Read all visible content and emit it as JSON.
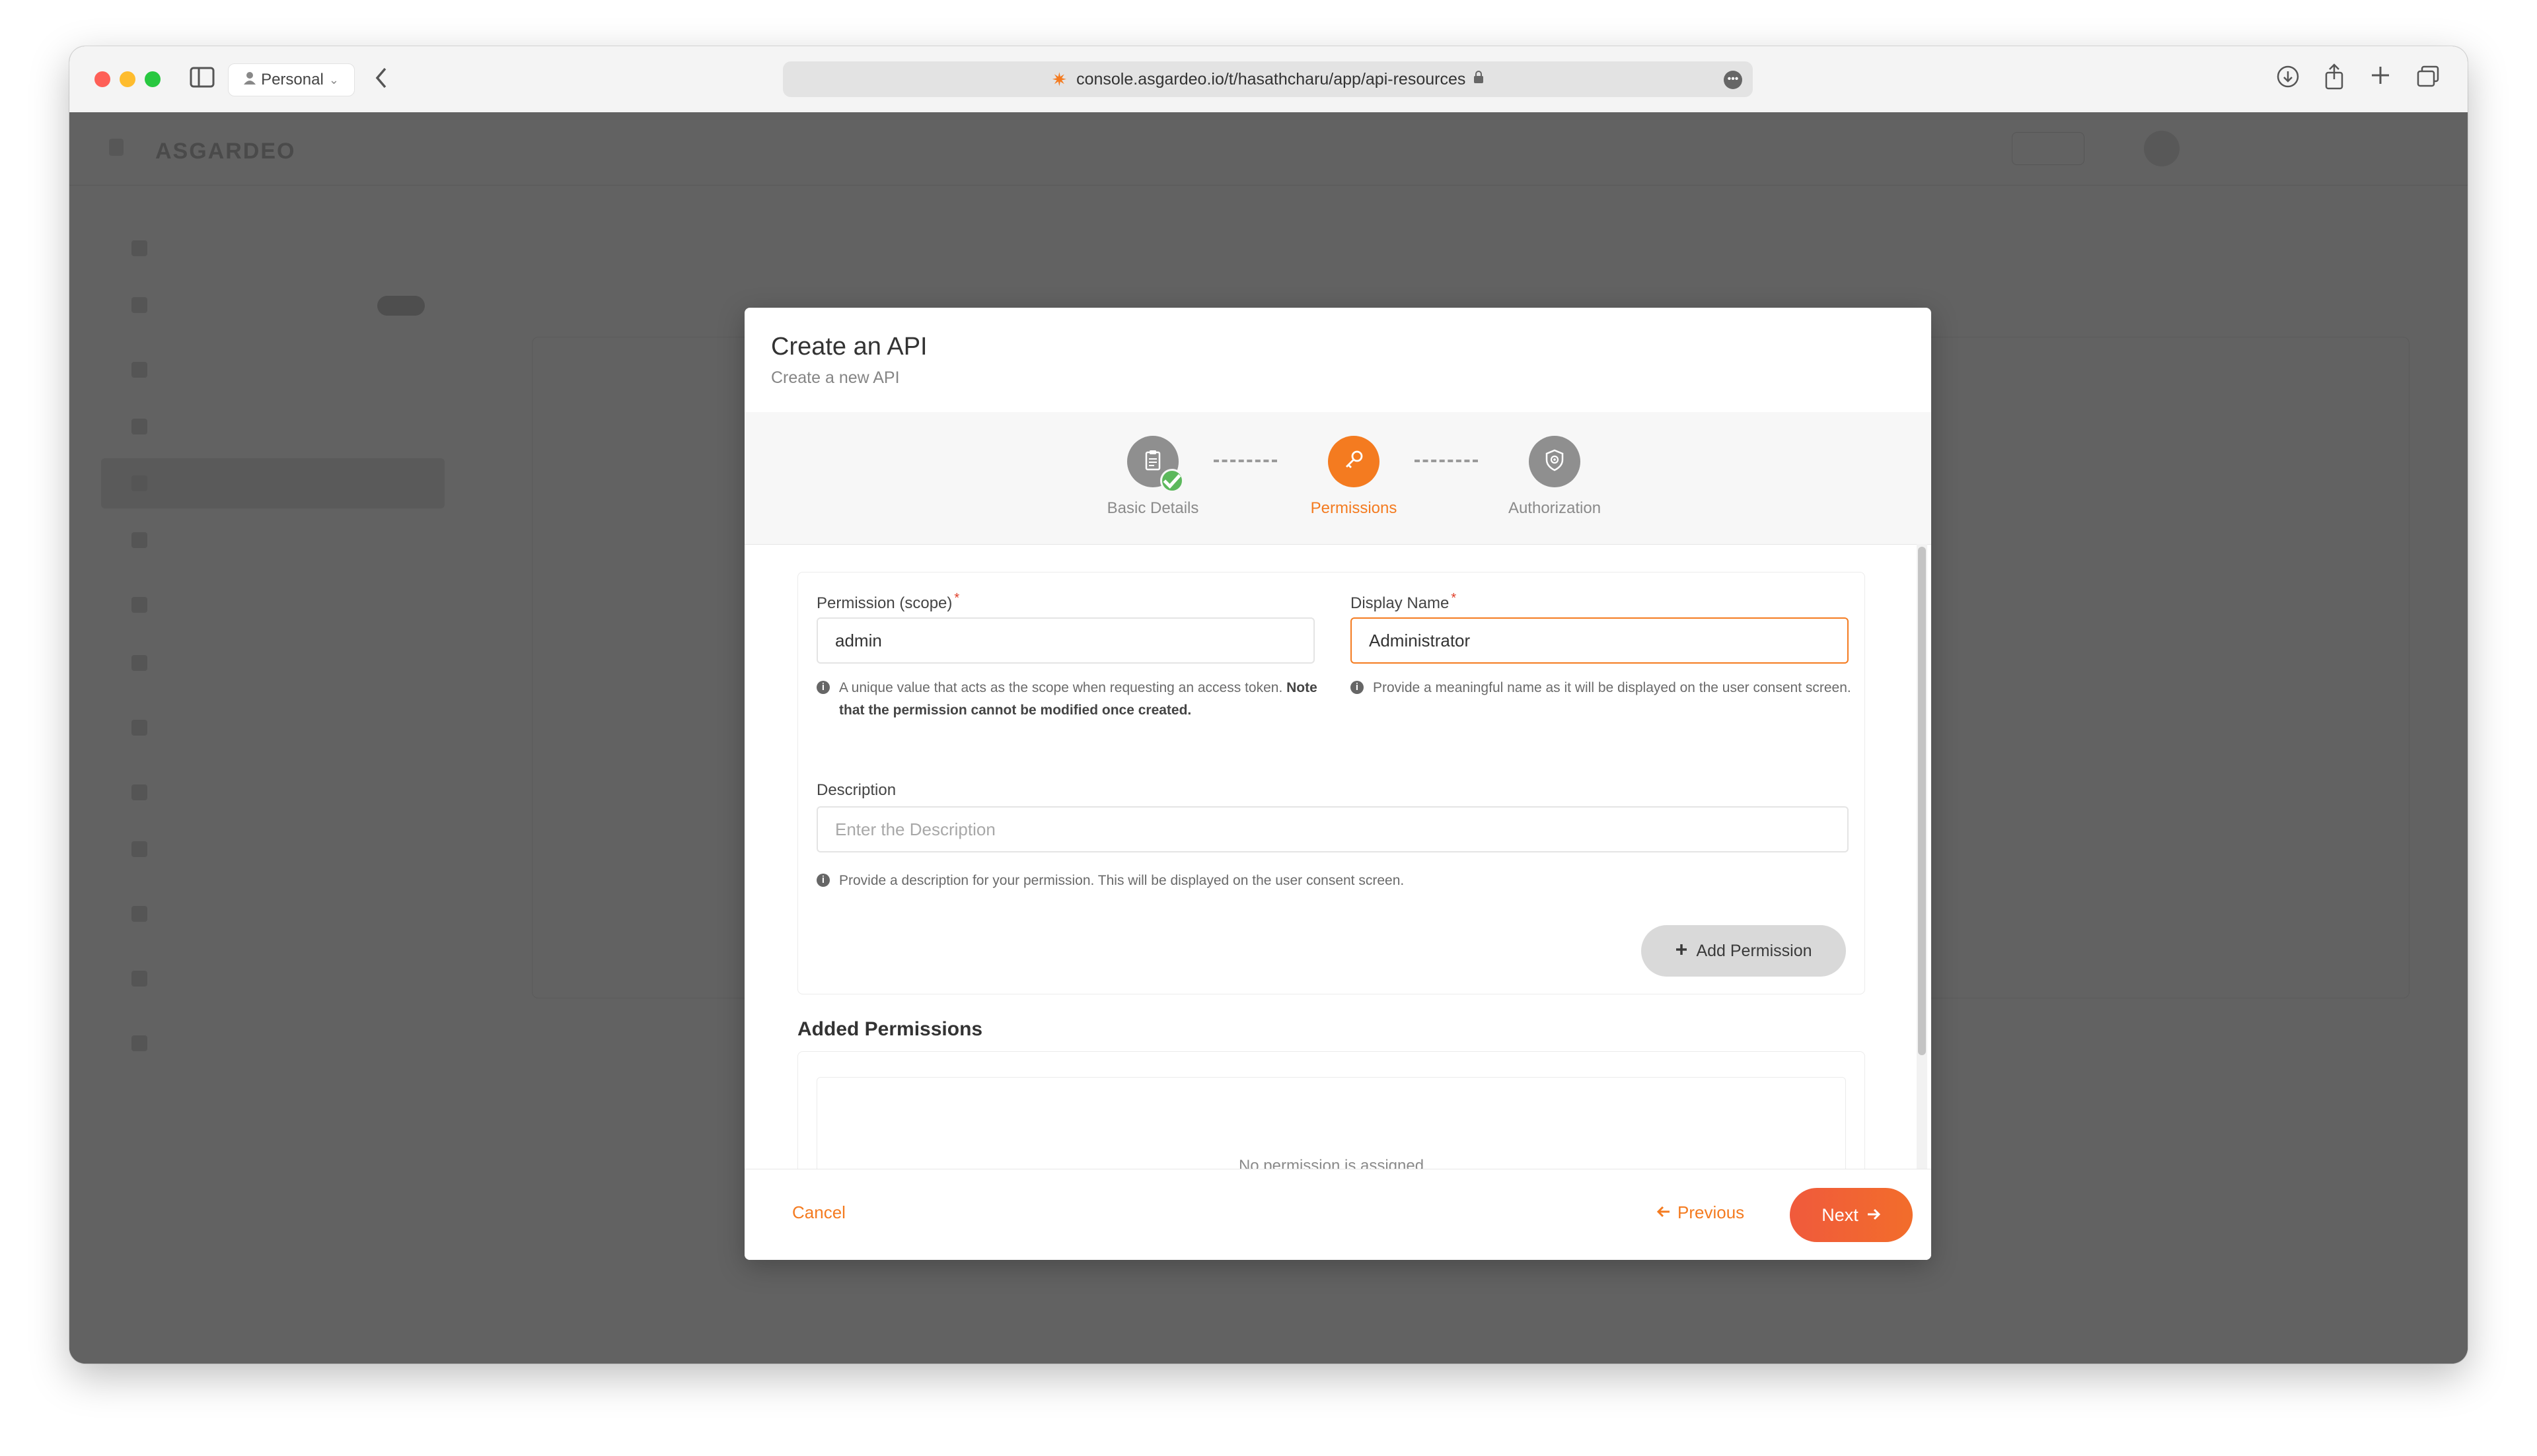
{
  "browser": {
    "profile_label": "Personal",
    "url": "console.asgardeo.io/t/hasathcharu/app/api-resources"
  },
  "modal": {
    "title": "Create an API",
    "subtitle": "Create a new API",
    "steps": [
      {
        "label": "Basic Details",
        "state": "completed",
        "icon": "clipboard-icon"
      },
      {
        "label": "Permissions",
        "state": "active",
        "icon": "key-icon"
      },
      {
        "label": "Authorization",
        "state": "pending",
        "icon": "shield-icon"
      }
    ],
    "permission_form": {
      "scope_label": "Permission (scope)",
      "scope_value": "admin",
      "scope_hint": "A unique value that acts as the scope when requesting an access token.",
      "scope_hint_bold": "Note that the permission cannot be modified once created.",
      "display_name_label": "Display Name",
      "display_name_value": "Administrator",
      "display_name_hint": "Provide a meaningful name as it will be displayed on the user consent screen.",
      "description_label": "Description",
      "description_placeholder": "Enter the Description",
      "description_hint": "Provide a description for your permission. This will be displayed on the user consent screen.",
      "add_button_label": "Add Permission"
    },
    "added_permissions": {
      "title": "Added Permissions",
      "empty_message": "No permission is assigned"
    },
    "footer": {
      "cancel_label": "Cancel",
      "previous_label": "Previous",
      "next_label": "Next"
    }
  },
  "colors": {
    "accent": "#f47b20",
    "next_button": "#f05a3c",
    "step_complete": "#5cb85c",
    "overlay": "#626262"
  }
}
